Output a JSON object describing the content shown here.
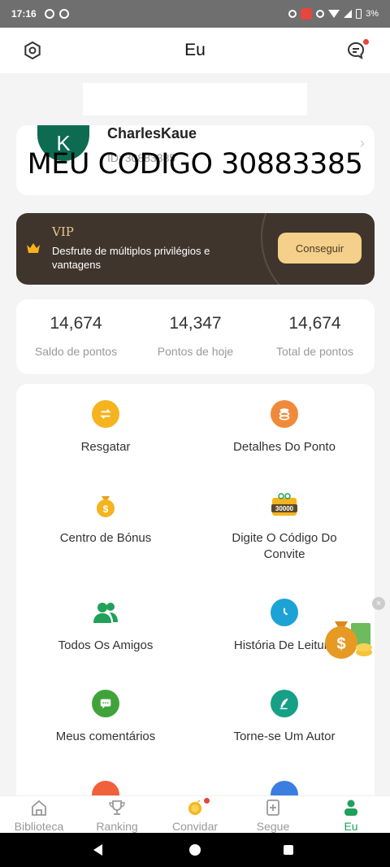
{
  "status_bar": {
    "time": "17:16",
    "battery": "3%"
  },
  "app_bar": {
    "title": "Eu"
  },
  "profile": {
    "avatar_letter": "K",
    "username": "CharlesKaue",
    "user_id": "ID: 30883385"
  },
  "overlay": {
    "text": "MEU CODIGO 30883385"
  },
  "vip": {
    "label": "VIP",
    "description": "Desfrute de múltiplos privilégios e vantagens",
    "button": "Conseguir"
  },
  "points": [
    {
      "value": "14,674",
      "label": "Saldo de pontos"
    },
    {
      "value": "14,347",
      "label": "Pontos de hoje"
    },
    {
      "value": "14,674",
      "label": "Total de pontos"
    }
  ],
  "menu": [
    {
      "label": "Resgatar",
      "icon": "exchange-icon",
      "color": "#f5b41e"
    },
    {
      "label": "Detalhes Do Ponto",
      "icon": "coins-icon",
      "color": "#f08a3a"
    },
    {
      "label": "Centro de Bónus",
      "icon": "money-bag-icon",
      "color": "#f5b41e"
    },
    {
      "label": "Digite O Código Do Convite",
      "icon": "gift-box-icon",
      "badge": "30000",
      "color": "#f5b41e"
    },
    {
      "label": "Todos Os Amigos",
      "icon": "friends-icon",
      "color": "#21a05a"
    },
    {
      "label": "História De Leitura",
      "icon": "clock-icon",
      "color": "#1ca3d6"
    },
    {
      "label": "Meus comentários",
      "icon": "comment-icon",
      "color": "#3fa33a"
    },
    {
      "label": "Torne-se Um Autor",
      "icon": "pen-icon",
      "color": "#16a085"
    }
  ],
  "bottom_nav": [
    {
      "label": "Biblioteca",
      "icon": "library-icon"
    },
    {
      "label": "Ranking",
      "icon": "trophy-icon"
    },
    {
      "label": "Convidar",
      "icon": "coin-icon"
    },
    {
      "label": "Segue",
      "icon": "bookmark-add-icon"
    },
    {
      "label": "Eu",
      "icon": "person-icon",
      "active": true
    }
  ]
}
